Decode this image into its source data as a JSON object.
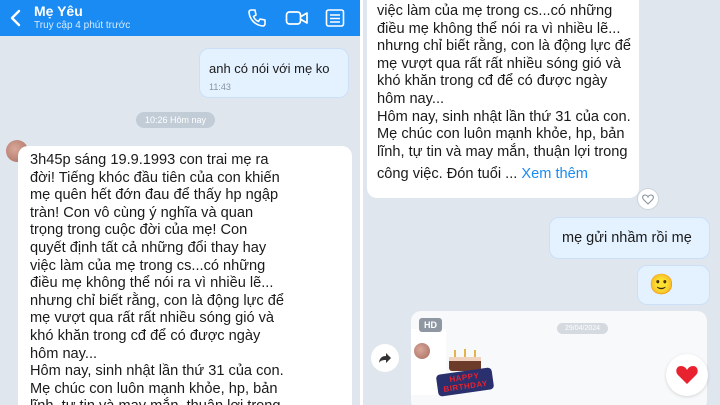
{
  "header": {
    "contact_name": "Mẹ Yêu",
    "status": "Truy cập 4 phút trước",
    "icons": [
      "back-arrow-icon",
      "phone-icon",
      "video-call-icon",
      "list-menu-icon"
    ]
  },
  "left": {
    "sent_message": {
      "text": "anh có nói với mẹ ko",
      "time": "11:43"
    },
    "time_divider": "10:26 Hôm nay",
    "long_message_lines": [
      "3h45p sáng 19.9.1993 con trai mẹ ra",
      "đời! Tiếng khóc đầu tiên của con khiến",
      "mẹ quên hết đớn đau để thấy hp ngập",
      "tràn! Con vô cùng ý nghĩa và quan",
      "trọng trong cuộc đời của mẹ! Con",
      "quyết định tất cả những đổi thay hay",
      "việc làm của mẹ trong cs...có những",
      "điều mẹ không thể nói ra vì nhiều lẽ...",
      "nhưng chỉ biết rằng, con là động lực để",
      "mẹ vượt qua rất rất nhiều sóng gió và",
      "khó khăn trong cđ để có được ngày",
      "hôm nay...",
      "Hôm nay, sinh nhật lần thứ 31 của con.",
      "Mẹ chúc con luôn mạnh khỏe, hp, bản",
      "lĩnh, tự tin và may mắn, thuận lợi trong"
    ]
  },
  "right": {
    "long_message_lines": [
      "việc làm của mẹ trong cs...có những",
      "điều mẹ không thể nói ra vì nhiều lẽ...",
      "nhưng chỉ biết rằng, con là động lực để",
      "mẹ vượt qua rất rất nhiều sóng gió và",
      "khó khăn trong cđ để có được ngày",
      "hôm nay...",
      "Hôm nay, sinh nhật lần thứ 31 của con.",
      "Mẹ chúc con luôn mạnh khỏe, hp, bản",
      "lĩnh, tự tin và may mắn, thuận lợi trong"
    ],
    "last_line": "công việc. Đón tuổi ...",
    "see_more": "Xem thêm",
    "sent_message": "mẹ gửi nhầm rồi mẹ",
    "emoji": "🙂",
    "media_badge": "HD",
    "media_date": "29/04/2024",
    "sticker_text": "HAPPY BIRTHDAY"
  },
  "colors": {
    "header_blue": "#1a8bf2",
    "chat_background": "#dfe6ee",
    "sent_bubble": "#e4f1ff",
    "received_bubble": "#ffffff",
    "link_blue": "#1a8bf2",
    "heart_red": "#e8232f"
  }
}
